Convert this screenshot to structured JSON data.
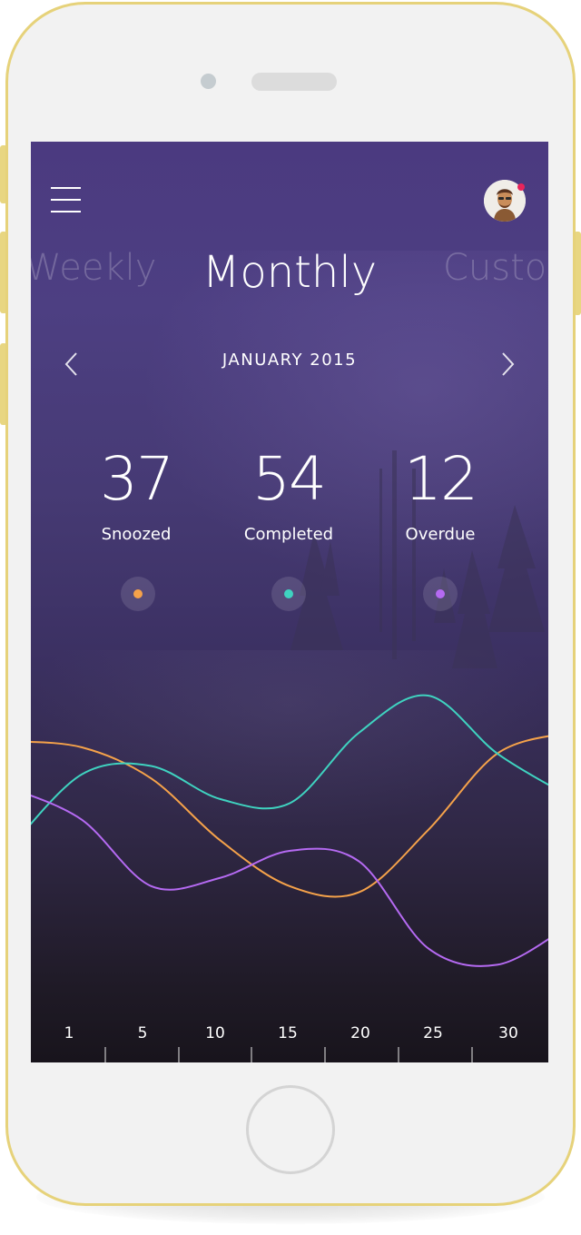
{
  "header": {
    "menu_icon": "hamburger-menu-icon",
    "avatar_icon": "user-avatar-icon",
    "notification_color": "#e8245a"
  },
  "periods": {
    "previous": "Weekly",
    "current": "Monthly",
    "next": "Custom"
  },
  "month_nav": {
    "label": "JANUARY 2015",
    "prev_icon": "chevron-left-icon",
    "next_icon": "chevron-right-icon"
  },
  "stats": [
    {
      "value": "37",
      "label": "Snoozed",
      "color": "#f5a24a"
    },
    {
      "value": "54",
      "label": "Completed",
      "color": "#3fd3c0"
    },
    {
      "value": "12",
      "label": "Overdue",
      "color": "#b56af2"
    }
  ],
  "chart_data": {
    "type": "line",
    "x_ticks": [
      "1",
      "5",
      "10",
      "15",
      "20",
      "25",
      "30"
    ],
    "smooth": true,
    "series": [
      {
        "key": "snoozed",
        "color": "#f5a24a",
        "values": [
          0.78,
          0.75,
          0.6,
          0.3,
          0.08,
          0.05,
          0.35,
          0.72,
          0.82
        ]
      },
      {
        "key": "completed",
        "color": "#3fd3c0",
        "values": [
          0.28,
          0.62,
          0.66,
          0.5,
          0.48,
          0.82,
          1.0,
          0.72,
          0.52
        ]
      },
      {
        "key": "overdue",
        "color": "#b56af2",
        "values": [
          0.55,
          0.4,
          0.08,
          0.12,
          0.25,
          0.2,
          -0.22,
          -0.3,
          -0.12
        ]
      }
    ]
  }
}
